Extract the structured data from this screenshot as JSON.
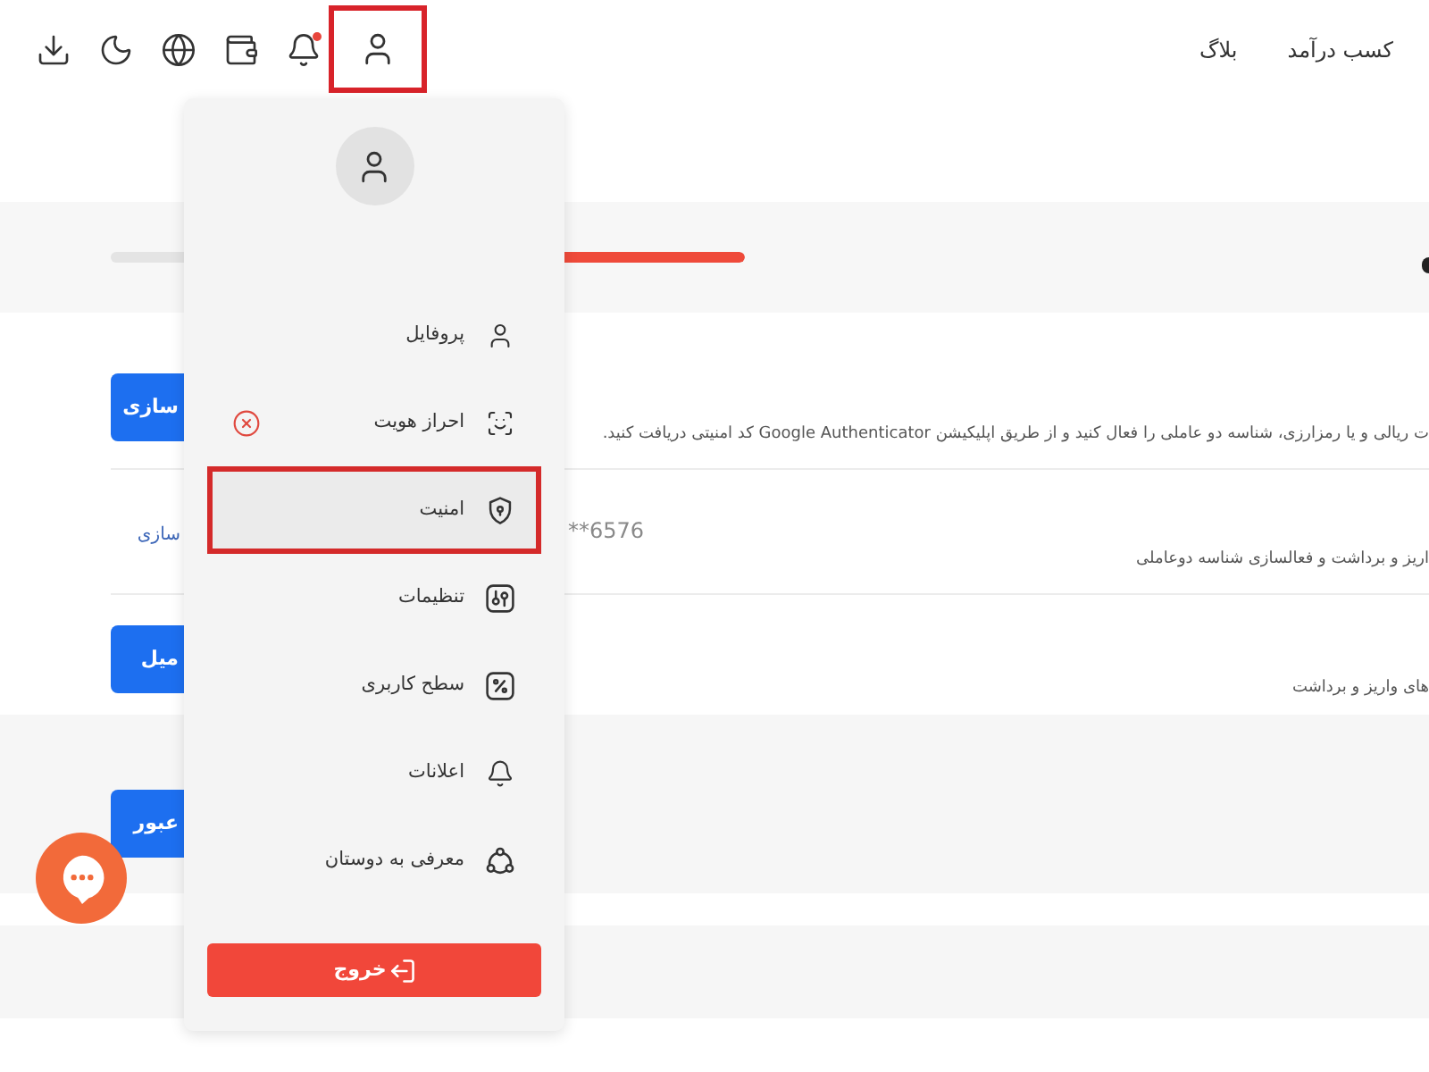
{
  "header": {
    "nav": [
      {
        "label": "کسب درآمد"
      },
      {
        "label": "بلاگ"
      }
    ],
    "notification_dot": true,
    "account_highlighted": true
  },
  "progress": {
    "level": 0.5
  },
  "rows": [
    {
      "kind": "button",
      "action": "سازی",
      "description": "ت ریالی و یا رمزارزی، شناسه دو عاملی را فعال کنید و از طریق اپلیکیشن  Google Authenticator کد امنیتی دریافت کنید."
    },
    {
      "kind": "link",
      "action": "سازی",
      "value": "**6576",
      "description": "اریز و برداشت و فعالسازی شناسه دوعاملی"
    },
    {
      "kind": "button",
      "action": "میل",
      "description": "های واریز و برداشت"
    }
  ],
  "lower_section": {
    "button": "عبور"
  },
  "account_menu": {
    "items": [
      {
        "label": "پروفایل",
        "selected": false,
        "alert": false
      },
      {
        "label": "احراز هویت",
        "selected": false,
        "alert": true
      },
      {
        "label": "امنیت",
        "selected": true,
        "alert": false
      },
      {
        "label": "تنظیمات",
        "selected": false,
        "alert": false
      },
      {
        "label": "سطح کاربری",
        "selected": false,
        "alert": false
      },
      {
        "label": "اعلانات",
        "selected": false,
        "alert": false
      },
      {
        "label": "معرفی به دوستان",
        "selected": false,
        "alert": false
      }
    ],
    "logout": "خروج"
  }
}
